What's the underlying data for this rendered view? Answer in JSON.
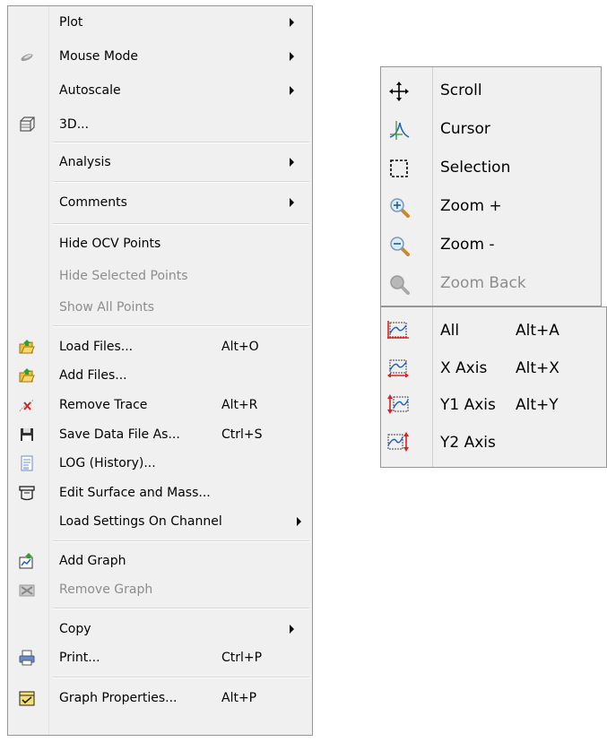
{
  "context_menu": {
    "items": [
      {
        "label": "Plot",
        "icon": "none"
      },
      {
        "label": "Mouse Mode",
        "icon": "eraser-icon"
      },
      {
        "label": "Autoscale",
        "icon": "none"
      },
      {
        "label": "3D...",
        "icon": "3d-box-icon"
      },
      {
        "label": "Analysis",
        "icon": "none"
      },
      {
        "label": "Comments",
        "icon": "none"
      },
      {
        "label": "Hide OCV Points",
        "icon": "none"
      },
      {
        "label": "Hide Selected Points",
        "icon": "none",
        "disabled": true
      },
      {
        "label": "Show All Points",
        "icon": "none",
        "disabled": true
      },
      {
        "label": "Load Files...",
        "shortcut": "Alt+O",
        "icon": "folder-open-icon"
      },
      {
        "label": "Add Files...",
        "icon": "folder-add-icon"
      },
      {
        "label": "Remove Trace",
        "shortcut": "Alt+R",
        "icon": "remove-trace-icon"
      },
      {
        "label": "Save Data File As...",
        "shortcut": "Ctrl+S",
        "icon": "floppy-icon"
      },
      {
        "label": "LOG (History)...",
        "icon": "log-document-icon"
      },
      {
        "label": "Edit Surface and Mass...",
        "icon": "surface-icon"
      },
      {
        "label": "Load Settings On Channel",
        "icon": "none"
      },
      {
        "label": "Add Graph",
        "icon": "add-graph-icon"
      },
      {
        "label": "Remove Graph",
        "icon": "remove-graph-icon",
        "disabled": true
      },
      {
        "label": "Copy",
        "icon": "none"
      },
      {
        "label": "Print...",
        "shortcut": "Ctrl+P",
        "icon": "printer-icon"
      },
      {
        "label": "Graph Properties...",
        "shortcut": "Alt+P",
        "icon": "graph-properties-icon"
      }
    ]
  },
  "mouse_mode_menu": {
    "items": [
      {
        "label": "Scroll",
        "icon": "scroll-move-icon"
      },
      {
        "label": "Cursor",
        "icon": "cursor-peak-icon"
      },
      {
        "label": "Selection",
        "icon": "selection-rect-icon"
      },
      {
        "label": "Zoom +",
        "icon": "zoom-in-icon"
      },
      {
        "label": "Zoom -",
        "icon": "zoom-out-icon"
      },
      {
        "label": "Zoom Back",
        "icon": "zoom-back-icon",
        "disabled": true
      }
    ]
  },
  "autoscale_menu": {
    "items": [
      {
        "label": "All",
        "shortcut": "Alt+A",
        "icon": "autoscale-all-icon"
      },
      {
        "label": "X Axis",
        "shortcut": "Alt+X",
        "icon": "autoscale-x-icon"
      },
      {
        "label": "Y1 Axis",
        "shortcut": "Alt+Y",
        "icon": "autoscale-y1-icon"
      },
      {
        "label": "Y2 Axis",
        "icon": "autoscale-y2-icon"
      }
    ]
  },
  "colors": {
    "menu_bg": "#f0f0f0",
    "border": "#979797",
    "disabled_text": "#8d8d8d",
    "icon_red": "#e02020",
    "icon_blue": "#2060c0",
    "icon_green": "#40a040"
  }
}
